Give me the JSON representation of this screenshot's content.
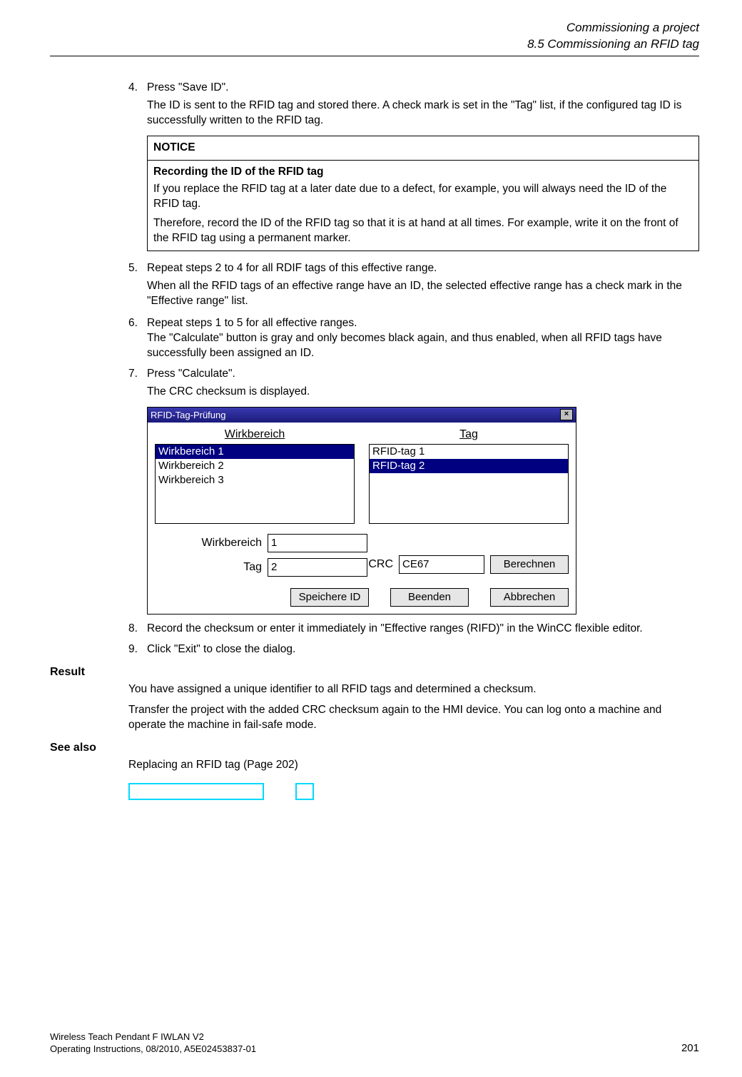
{
  "header": {
    "chapter": "Commissioning a project",
    "section": "8.5 Commissioning an RFID tag"
  },
  "steps": {
    "s4_num": "4.",
    "s4_text": "Press \"Save ID\".",
    "s4_desc": "The ID is sent to the RFID tag and stored there. A check mark is set in the \"Tag\" list, if the configured tag ID is successfully written to the RFID tag.",
    "s5_num": "5.",
    "s5_text": "Repeat steps 2 to 4 for all RDIF tags of this effective range.",
    "s5_desc": "When all the RFID tags of an effective range have an ID, the selected effective range has a check mark in the \"Effective range\" list.",
    "s6_num": "6.",
    "s6_text": "Repeat steps 1 to 5 for all effective ranges.",
    "s6_desc_inline": "The \"Calculate\" button is gray and only becomes black again, and thus enabled, when all RFID tags have successfully been assigned an ID.",
    "s7_num": "7.",
    "s7_text": "Press \"Calculate\".",
    "s7_desc": "The CRC checksum is displayed.",
    "s8_num": "8.",
    "s8_text": "Record the checksum or enter it immediately in \"Effective ranges (RIFD)\" in the WinCC flexible editor.",
    "s9_num": "9.",
    "s9_text": "Click \"Exit\" to close the dialog."
  },
  "notice": {
    "title": "NOTICE",
    "subtitle": "Recording the ID of the RFID tag",
    "p1": "If you replace the RFID tag at a later date due to a defect, for example, you will always need the ID of the RFID tag.",
    "p2": "Therefore, record the ID of the RFID tag so that it is at hand at all times. For example, write it on the front of the RFID tag using a permanent marker."
  },
  "dialog": {
    "title": "RFID-Tag-Prüfung",
    "list1_head": "Wirkbereich",
    "list2_head": "Tag",
    "wirk_items": [
      "Wirkbereich 1",
      "Wirkbereich 2",
      "Wirkbereich 3"
    ],
    "tag_items": [
      "RFID-tag 1",
      "RFID-tag 2"
    ],
    "lbl_wirk": "Wirkbereich",
    "lbl_tag": "Tag",
    "lbl_crc": "CRC",
    "val_wirk": "1",
    "val_tag": "2",
    "val_crc": "CE67",
    "btn_berechnen": "Berechnen",
    "btn_speichere": "Speichere ID",
    "btn_beenden": "Beenden",
    "btn_abbrechen": "Abbrechen",
    "close_x": "×"
  },
  "result": {
    "head": "Result",
    "p1": "You have assigned a unique identifier to all RFID tags and determined a checksum.",
    "p2": "Transfer the project with the added CRC checksum again to the HMI device. You can log onto a machine and operate the machine in fail-safe mode."
  },
  "seealso": {
    "head": "See also",
    "p1": "Replacing an RFID tag (Page 202)"
  },
  "footer": {
    "line1": "Wireless Teach Pendant F IWLAN V2",
    "line2": "Operating Instructions, 08/2010, A5E02453837-01",
    "page": "201"
  }
}
